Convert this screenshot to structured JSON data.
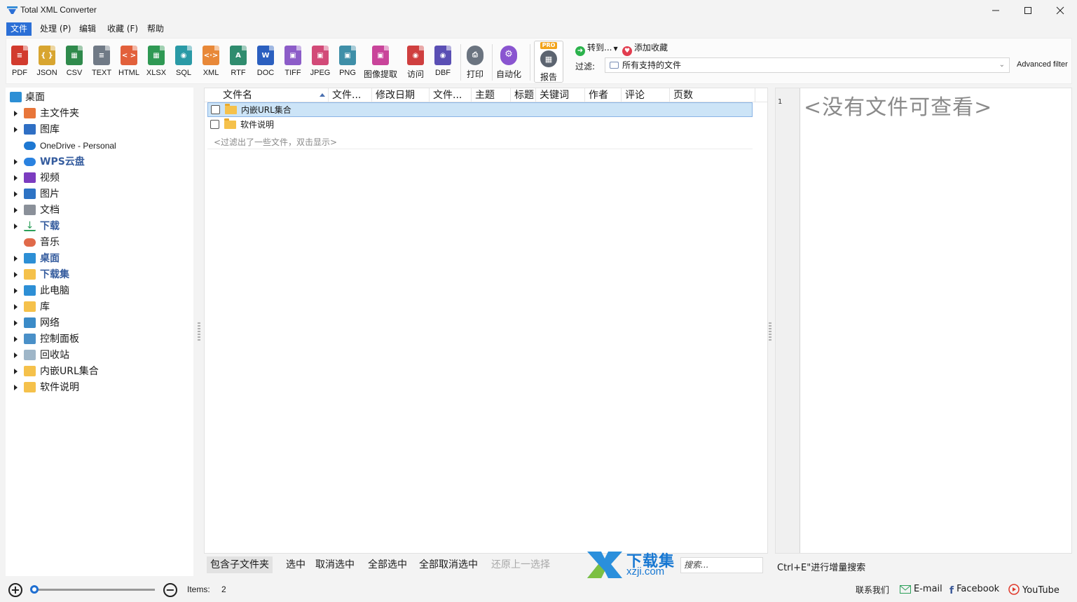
{
  "window": {
    "title": "Total XML Converter"
  },
  "menu": {
    "items": [
      "文件",
      "处理 (P)",
      "编辑",
      "收藏 (F)",
      "帮助"
    ]
  },
  "toolbar": {
    "formats": [
      {
        "label": "PDF",
        "color": "#d23b2e",
        "glyph": "≡"
      },
      {
        "label": "JSON",
        "color": "#d8a530",
        "glyph": "{ }"
      },
      {
        "label": "CSV",
        "color": "#2f8a4c",
        "glyph": "▦"
      },
      {
        "label": "TEXT",
        "color": "#707a86",
        "glyph": "≡"
      },
      {
        "label": "HTML",
        "color": "#e2603b",
        "glyph": "< >"
      },
      {
        "label": "XLSX",
        "color": "#2f9954",
        "glyph": "▦"
      },
      {
        "label": "SQL",
        "color": "#2a9aa6",
        "glyph": "◉"
      },
      {
        "label": "XML",
        "color": "#e88838",
        "glyph": "<·>"
      },
      {
        "label": "RTF",
        "color": "#2f8c6e",
        "glyph": "A"
      },
      {
        "label": "DOC",
        "color": "#2b5fbf",
        "glyph": "W"
      },
      {
        "label": "TIFF",
        "color": "#8c5cc8",
        "glyph": "▣"
      },
      {
        "label": "JPEG",
        "color": "#d24a78",
        "glyph": "▣"
      },
      {
        "label": "PNG",
        "color": "#3f8fa8",
        "glyph": "▣"
      },
      {
        "label": "图像提取",
        "color": "#c9449a",
        "glyph": "▣"
      },
      {
        "label": "访问",
        "color": "#cf3f3f",
        "glyph": "◉"
      },
      {
        "label": "DBF",
        "color": "#5a4fb4",
        "glyph": "◉"
      }
    ],
    "print_label": "打印",
    "automate_label": "自动化",
    "report_label": "报告",
    "pro_badge": "PRO",
    "goto_label": "转到...",
    "favorites_label": "添加收藏",
    "filter_label": "过滤:",
    "filter_value": "所有支持的文件",
    "advanced_filter_label": "Advanced filter"
  },
  "tree": {
    "items": [
      {
        "label": "桌面",
        "icon": "desktop-icon",
        "color": "#2d8fd5",
        "expander": false,
        "style": "normal",
        "indent": 0
      },
      {
        "label": "主文件夹",
        "icon": "home-icon",
        "color": "#e8763a",
        "expander": true,
        "style": "normal",
        "indent": 1
      },
      {
        "label": "图库",
        "icon": "gallery-icon",
        "color": "#2f6fc4",
        "expander": true,
        "style": "normal",
        "indent": 1
      },
      {
        "label": "OneDrive - Personal",
        "icon": "cloud-icon",
        "color": "#1e78d2",
        "expander": false,
        "style": "small",
        "indent": 1
      },
      {
        "label": "WPS云盘",
        "icon": "cloud-icon",
        "color": "#2a82e0",
        "expander": true,
        "style": "bold",
        "indent": 1
      },
      {
        "label": "视频",
        "icon": "video-icon",
        "color": "#7c3cc0",
        "expander": true,
        "style": "normal",
        "indent": 1
      },
      {
        "label": "图片",
        "icon": "picture-icon",
        "color": "#2d73c4",
        "expander": true,
        "style": "normal",
        "indent": 1
      },
      {
        "label": "文档",
        "icon": "document-icon",
        "color": "#8a9099",
        "expander": true,
        "style": "normal",
        "indent": 1
      },
      {
        "label": "下载",
        "icon": "download-icon",
        "color": "#2da05a",
        "expander": true,
        "style": "bold",
        "indent": 1
      },
      {
        "label": "音乐",
        "icon": "music-icon",
        "color": "#e06a4a",
        "expander": false,
        "style": "normal",
        "indent": 1
      },
      {
        "label": "桌面",
        "icon": "desktop-icon",
        "color": "#2d8fd5",
        "expander": true,
        "style": "bold",
        "indent": 1
      },
      {
        "label": "下载集",
        "icon": "folder-icon",
        "color": "#f5c14b",
        "expander": true,
        "style": "bold",
        "indent": 1
      },
      {
        "label": "此电脑",
        "icon": "computer-icon",
        "color": "#2d8fd5",
        "expander": true,
        "style": "normal",
        "indent": 1
      },
      {
        "label": "库",
        "icon": "folder-icon",
        "color": "#f5c14b",
        "expander": true,
        "style": "normal",
        "indent": 1
      },
      {
        "label": "网络",
        "icon": "network-icon",
        "color": "#3b8bc8",
        "expander": true,
        "style": "normal",
        "indent": 1
      },
      {
        "label": "控制面板",
        "icon": "control-panel-icon",
        "color": "#4a90c8",
        "expander": true,
        "style": "normal",
        "indent": 1
      },
      {
        "label": "回收站",
        "icon": "recycle-bin-icon",
        "color": "#9fb6c8",
        "expander": true,
        "style": "normal",
        "indent": 1
      },
      {
        "label": "内嵌URL集合",
        "icon": "folder-icon",
        "color": "#f5c14b",
        "expander": true,
        "style": "normal",
        "indent": 1
      },
      {
        "label": "软件说明",
        "icon": "folder-icon",
        "color": "#f5c14b",
        "expander": true,
        "style": "normal",
        "indent": 1
      }
    ]
  },
  "filelist": {
    "columns": [
      "文件名",
      "文件...",
      "修改日期",
      "文件...",
      "主题",
      "标题",
      "关键词",
      "作者",
      "评论",
      "页数"
    ],
    "rows": [
      {
        "name": "内嵌URL集合",
        "selected": true
      },
      {
        "name": "软件说明",
        "selected": false
      }
    ],
    "filtered_note": "<过滤出了一些文件，双击显示>"
  },
  "actions": {
    "include_subfolders": "包含子文件夹",
    "check": "选中",
    "uncheck": "取消选中",
    "check_all": "全部选中",
    "uncheck_all": "全部取消选中",
    "restore_selection": "还原上一选择",
    "search_placeholder": "搜索..."
  },
  "watermark": {
    "line1": "下载集",
    "line2": "xzji.com"
  },
  "preview": {
    "line_number": "1",
    "empty_message": "<没有文件可查看>",
    "hint": "Ctrl+E\"进行增量搜索"
  },
  "status": {
    "items_label": "Items:",
    "items_count": "2",
    "contact": "联系我们",
    "email": "E-mail",
    "facebook": "Facebook",
    "youtube": "YouTube"
  },
  "colors": {
    "accent": "#2b6fd6",
    "selection": "#cce4f7"
  }
}
